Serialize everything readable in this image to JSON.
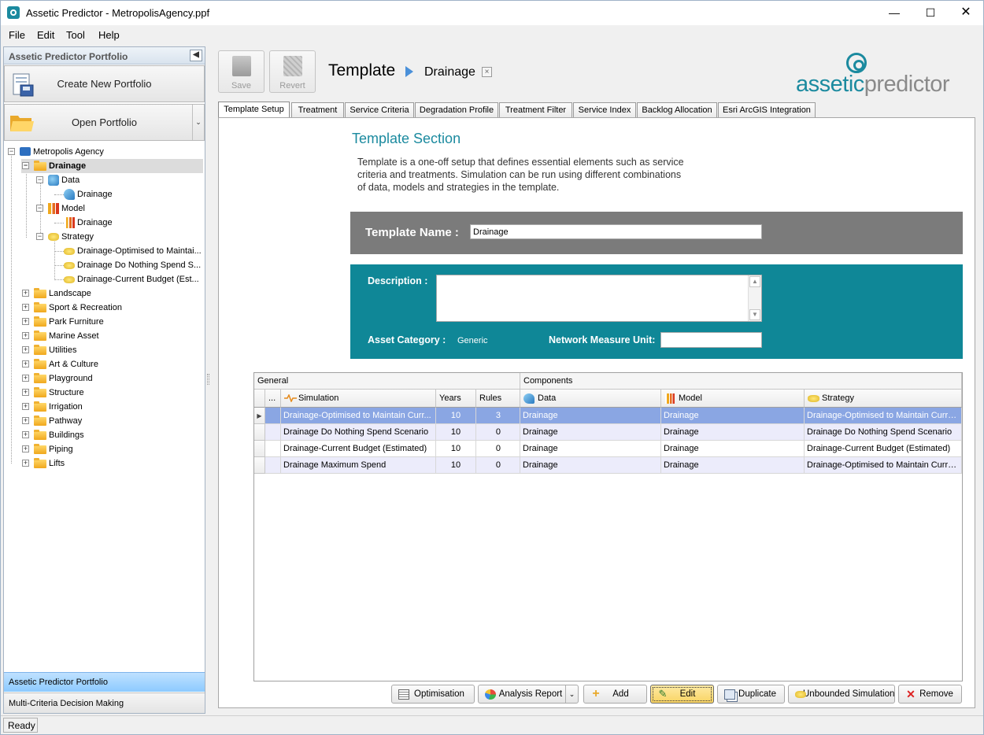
{
  "window": {
    "title": "Assetic Predictor - MetropolisAgency.ppf",
    "controls": [
      "minimize",
      "maximize",
      "close"
    ]
  },
  "menu": {
    "items": [
      "File",
      "Edit",
      "Tool",
      "Help"
    ]
  },
  "left_panel": {
    "header": "Assetic Predictor Portfolio",
    "create_button": "Create New Portfolio",
    "open_button": "Open Portfolio",
    "tree": {
      "root": "Metropolis Agency",
      "selected": "Drainage",
      "drainage_children": {
        "data": "Data",
        "data_item": "Drainage",
        "model": "Model",
        "model_item": "Drainage",
        "strategy": "Strategy",
        "strategies": [
          "Drainage-Optimised to Maintai...",
          "Drainage Do Nothing Spend S...",
          "Drainage-Current Budget (Est..."
        ]
      },
      "categories": [
        "Landscape",
        "Sport & Recreation",
        "Park Furniture",
        "Marine Asset",
        "Utilities",
        "Art & Culture",
        "Playground",
        "Structure",
        "Irrigation",
        "Pathway",
        "Buildings",
        "Piping",
        "Lifts"
      ]
    },
    "bottom_tabs": [
      "Assetic Predictor Portfolio",
      "Multi-Criteria Decision Making"
    ]
  },
  "toolbar": {
    "save": "Save",
    "revert": "Revert"
  },
  "header": {
    "title": "Template",
    "subtitle": "Drainage",
    "close_symbol": "×"
  },
  "logo": {
    "part1": "assetic",
    "part2": "predictor"
  },
  "tabs": [
    "Template Setup",
    "Treatment",
    "Service Criteria",
    "Degradation Profile",
    "Treatment Filter",
    "Service Index",
    "Backlog Allocation",
    "Esri ArcGIS Integration"
  ],
  "section": {
    "title": "Template Section",
    "description": "Template is a one-off setup that defines essential elements such as service criteria and treatments. Simulation can be run using different combinations of data, models and strategies in the template."
  },
  "form": {
    "template_name_label": "Template Name :",
    "template_name_value": "Drainage",
    "description_label": "Description :",
    "description_value": "",
    "asset_category_label": "Asset Category :",
    "asset_category_value": "Generic",
    "network_measure_label": "Network Measure Unit:",
    "network_measure_value": ""
  },
  "grid": {
    "bands": [
      "General",
      "Components"
    ],
    "columns": [
      "...",
      "Simulation",
      "Years",
      "Rules",
      "Data",
      "Model",
      "Strategy"
    ],
    "rows": [
      {
        "simulation": "Drainage-Optimised to Maintain Curr...",
        "years": "10",
        "rules": "3",
        "data": "Drainage",
        "model": "Drainage",
        "strategy": "Drainage-Optimised to Maintain Curre..."
      },
      {
        "simulation": "Drainage Do Nothing Spend Scenario",
        "years": "10",
        "rules": "0",
        "data": "Drainage",
        "model": "Drainage",
        "strategy": "Drainage Do Nothing Spend Scenario"
      },
      {
        "simulation": "Drainage-Current Budget (Estimated)",
        "years": "10",
        "rules": "0",
        "data": "Drainage",
        "model": "Drainage",
        "strategy": "Drainage-Current Budget (Estimated)"
      },
      {
        "simulation": "Drainage Maximum Spend",
        "years": "10",
        "rules": "0",
        "data": "Drainage",
        "model": "Drainage",
        "strategy": "Drainage-Optimised to Maintain Curre..."
      }
    ]
  },
  "actions": {
    "optimisation": "Optimisation",
    "analysis_report": "Analysis Report",
    "add": "Add",
    "edit": "Edit",
    "duplicate": "Duplicate",
    "unbounded": "Unbounded Simulation",
    "remove": "Remove"
  },
  "status": {
    "text": "Ready"
  },
  "colors": {
    "accent": "#1b8a9f",
    "description_band": "#0f8797",
    "name_band": "#7b7b7b",
    "selected_row": "#8aa6e3"
  }
}
